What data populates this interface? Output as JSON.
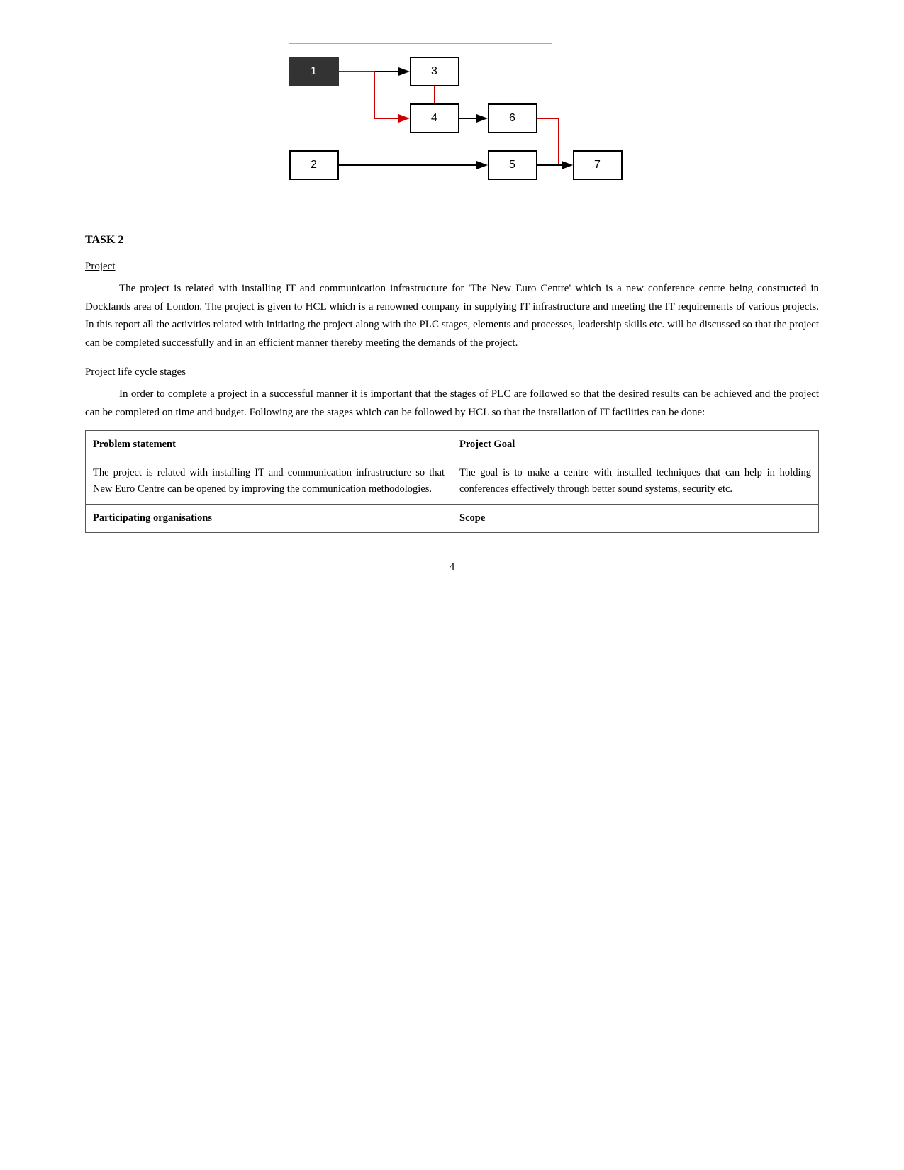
{
  "diagram": {
    "top_line_label": "top decorative line",
    "boxes": [
      {
        "id": "box-1",
        "label": "1"
      },
      {
        "id": "box-2",
        "label": "2"
      },
      {
        "id": "box-3",
        "label": "3"
      },
      {
        "id": "box-4",
        "label": "4"
      },
      {
        "id": "box-5",
        "label": "5"
      },
      {
        "id": "box-6",
        "label": "6"
      },
      {
        "id": "box-7",
        "label": "7"
      }
    ]
  },
  "task_heading": "TASK 2",
  "project_heading": "Project",
  "project_paragraph": "The project is related with installing IT and communication infrastructure for 'The New Euro Centre' which is a new conference centre being constructed in Docklands area of London. The project is given to HCL which is a renowned company in supplying IT infrastructure and meeting the IT requirements of various projects. In this report all the activities related with initiating the project along with the PLC stages, elements and processes, leadership skills etc. will be discussed so that the project can be completed successfully and in an efficient manner thereby meeting the demands of the project.",
  "plc_heading": "Project life cycle stages",
  "plc_paragraph": "In order to complete a project in a successful manner it is important that the stages of PLC are followed so that the desired results can be achieved and the project can be completed on time and budget. Following are the stages which can be followed by HCL so that the installation of IT facilities can be done:",
  "table": {
    "rows": [
      {
        "col1_header": true,
        "col1": "Problem statement",
        "col2_header": true,
        "col2": "Project Goal"
      },
      {
        "col1_header": false,
        "col1": "The project is related with installing IT and communication infrastructure so that New Euro Centre can be opened by improving the communication methodologies.",
        "col2_header": false,
        "col2": "The goal is to make a centre with installed techniques that can help in holding conferences effectively through better sound systems, security etc."
      },
      {
        "col1_header": true,
        "col1": "Participating organisations",
        "col2_header": true,
        "col2": "Scope"
      }
    ]
  },
  "page_number": "4"
}
